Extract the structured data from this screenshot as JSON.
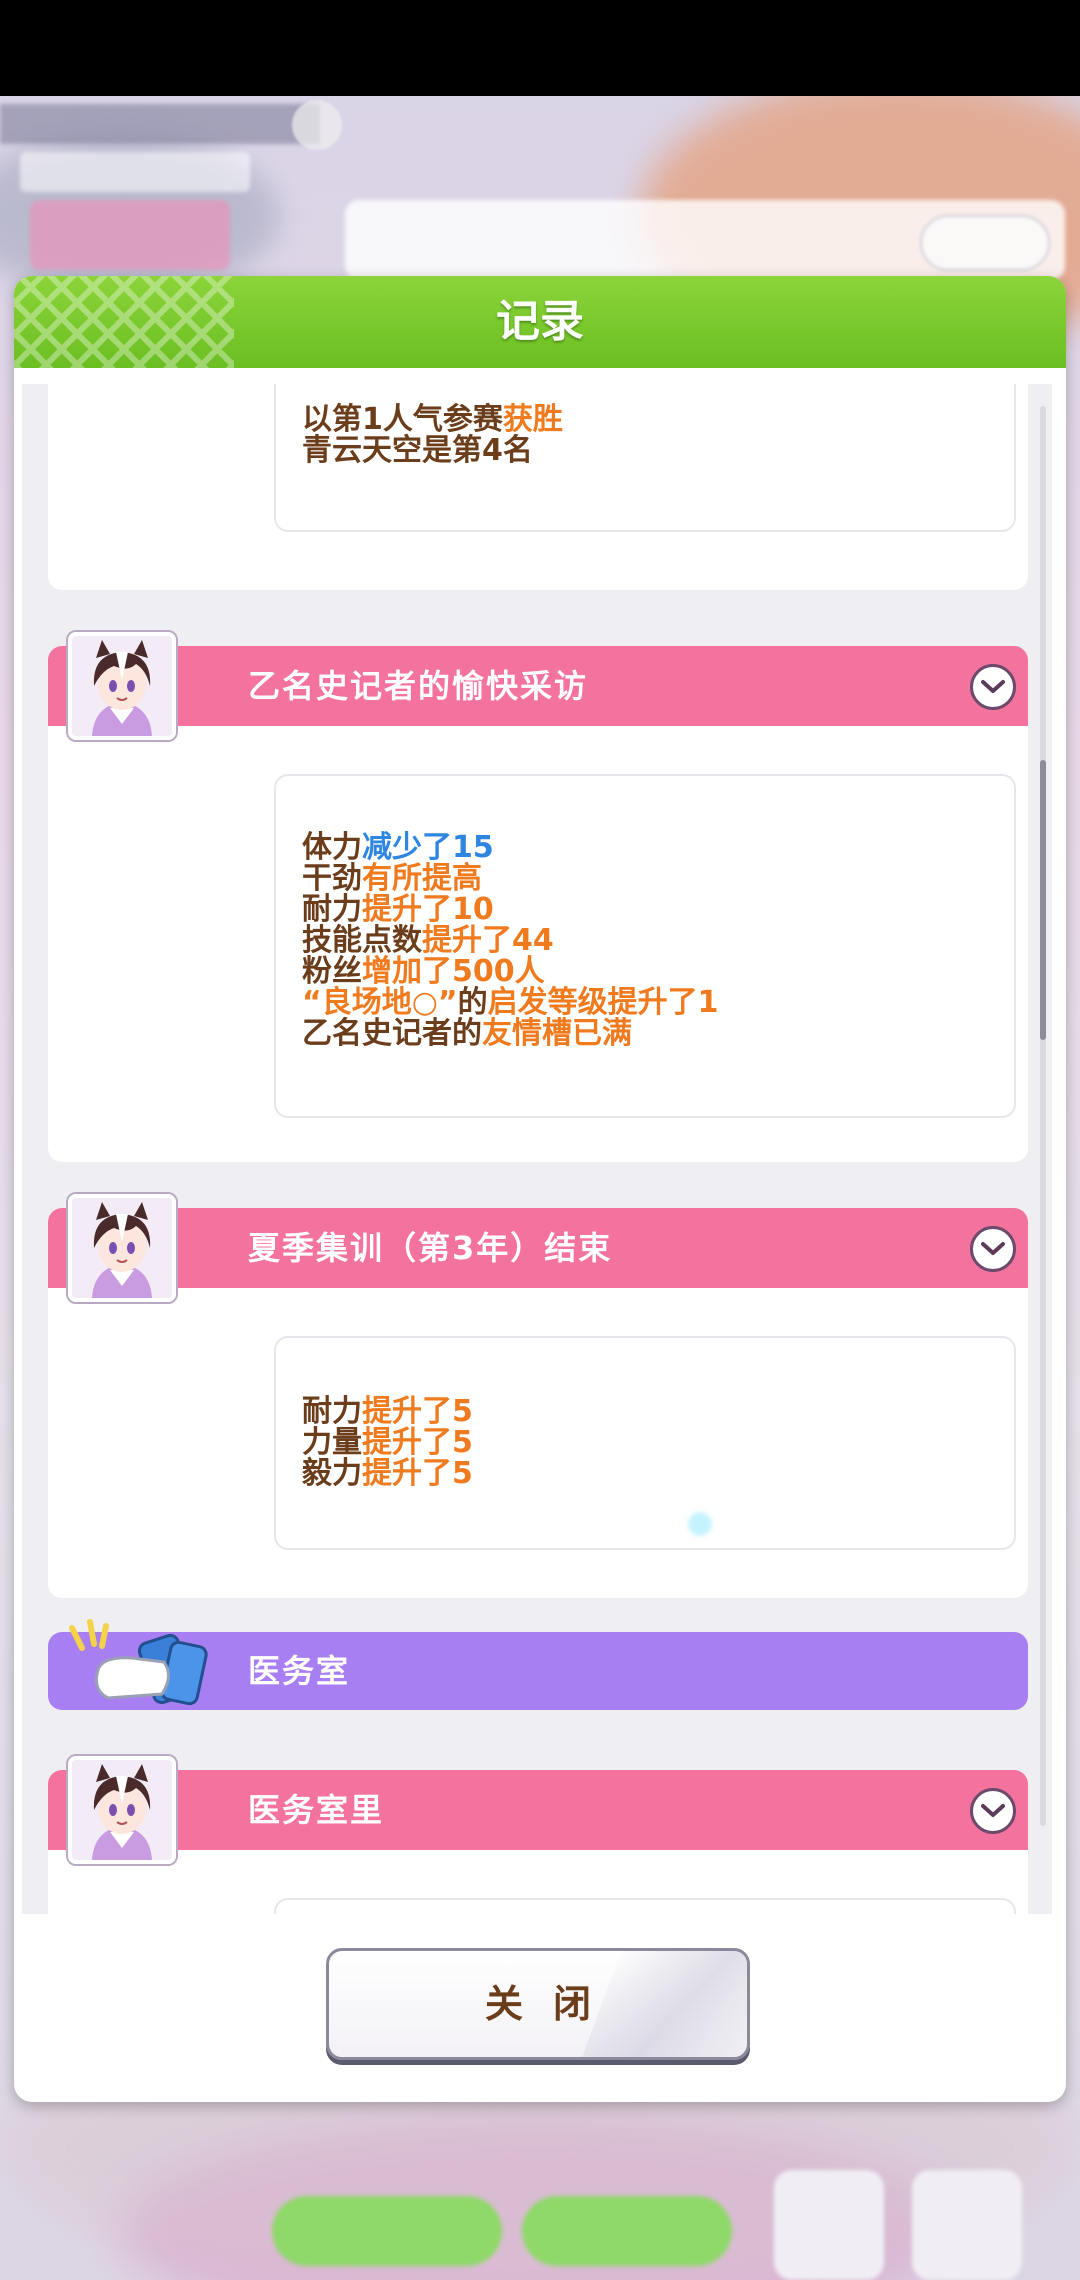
{
  "dialog": {
    "title": "记录",
    "close_label": "关闭"
  },
  "entries": [
    {
      "lines": [
        [
          {
            "t": "以第1人气参赛",
            "c": "n"
          },
          {
            "t": "获胜",
            "c": "o"
          }
        ],
        [
          {
            "t": "青云天空是第4名",
            "c": "n"
          }
        ]
      ]
    },
    {
      "title": "乙名史记者的愉快采访",
      "lines": [
        [
          {
            "t": "体力",
            "c": "n"
          },
          {
            "t": "减少了15",
            "c": "b"
          }
        ],
        [
          {
            "t": "干劲",
            "c": "n"
          },
          {
            "t": "有所提高",
            "c": "o"
          }
        ],
        [
          {
            "t": "耐力",
            "c": "n"
          },
          {
            "t": "提升了10",
            "c": "o"
          }
        ],
        [
          {
            "t": "技能点数",
            "c": "n"
          },
          {
            "t": "提升了44",
            "c": "o"
          }
        ],
        [
          {
            "t": "粉丝",
            "c": "n"
          },
          {
            "t": "增加了500人",
            "c": "o"
          }
        ],
        [
          {
            "t": "“良场地○”",
            "c": "o"
          },
          {
            "t": "的",
            "c": "n"
          },
          {
            "t": "启发等级提升了1",
            "c": "o"
          }
        ],
        [
          {
            "t": "乙名史记者的",
            "c": "n"
          },
          {
            "t": "友情槽已满",
            "c": "o"
          }
        ]
      ]
    },
    {
      "title": "夏季集训（第3年）结束",
      "lines": [
        [
          {
            "t": "耐力",
            "c": "n"
          },
          {
            "t": "提升了5",
            "c": "o"
          }
        ],
        [
          {
            "t": "力量",
            "c": "n"
          },
          {
            "t": "提升了5",
            "c": "o"
          }
        ],
        [
          {
            "t": "毅力",
            "c": "n"
          },
          {
            "t": "提升了5",
            "c": "o"
          }
        ]
      ]
    },
    {
      "section": "医务室"
    },
    {
      "title": "医务室里"
    }
  ],
  "colors": {
    "header_green": "#7cc62e",
    "event_pink": "#f4739e",
    "section_purple": "#a87ef3",
    "text_brown": "#6b3d1b",
    "text_orange": "#f07a1e",
    "text_blue": "#2f86e0"
  },
  "icons": [
    "chevron-down-icon",
    "character-avatar-icon",
    "infirmary-supplies-icon"
  ]
}
